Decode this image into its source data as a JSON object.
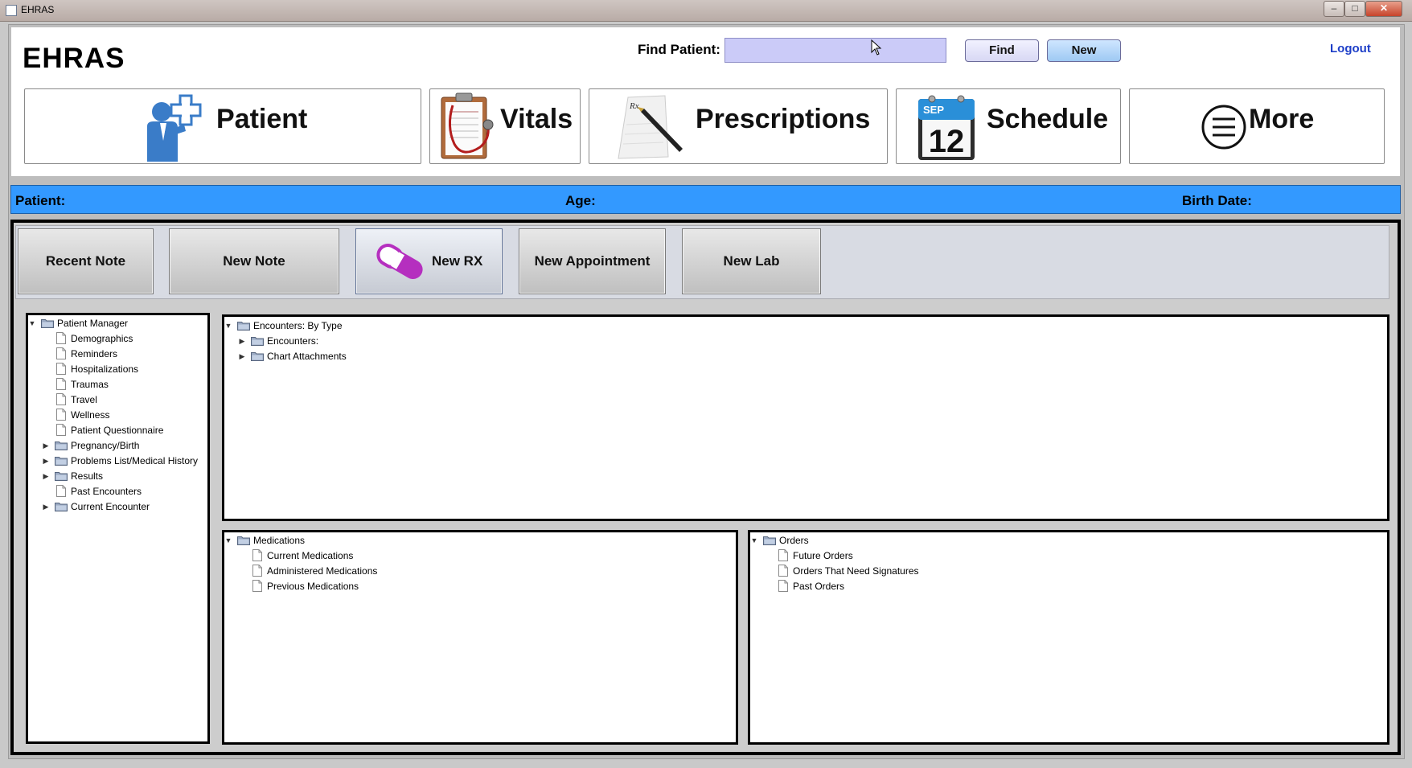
{
  "window": {
    "title": "EHRAS",
    "controls": [
      "–",
      "□",
      "✕"
    ]
  },
  "header": {
    "app_name": "EHRAS",
    "find_label": "Find Patient:",
    "find_value": "",
    "find_button": "Find",
    "new_button": "New",
    "logout": "Logout"
  },
  "nav": [
    {
      "label": "Patient",
      "icon": "patient-icon"
    },
    {
      "label": "Vitals",
      "icon": "clipboard-stethoscope-icon"
    },
    {
      "label": "Prescriptions",
      "icon": "prescription-pen-icon"
    },
    {
      "label": "Schedule",
      "icon": "calendar-icon",
      "calendar_month": "SEP",
      "calendar_day": "12"
    },
    {
      "label": "More",
      "icon": "menu-circle-icon"
    }
  ],
  "patient_bar": {
    "patient_label": "Patient:",
    "age_label": "Age:",
    "birth_label": "Birth Date:"
  },
  "actions": [
    {
      "label": "Recent Note"
    },
    {
      "label": "New Note"
    },
    {
      "label": "New RX",
      "icon": "pill-icon"
    },
    {
      "label": "New Appointment"
    },
    {
      "label": "New Lab"
    }
  ],
  "patient_tree": {
    "root": "Patient Manager",
    "items": [
      {
        "label": "Demographics",
        "type": "doc"
      },
      {
        "label": "Reminders",
        "type": "doc"
      },
      {
        "label": "Hospitalizations",
        "type": "doc"
      },
      {
        "label": "Traumas",
        "type": "doc"
      },
      {
        "label": "Travel",
        "type": "doc"
      },
      {
        "label": "Wellness",
        "type": "doc"
      },
      {
        "label": "Patient Questionnaire",
        "type": "doc"
      },
      {
        "label": "Pregnancy/Birth",
        "type": "folder"
      },
      {
        "label": "Problems List/Medical History",
        "type": "folder"
      },
      {
        "label": "Results",
        "type": "folder"
      },
      {
        "label": "Past Encounters",
        "type": "doc"
      },
      {
        "label": "Current Encounter",
        "type": "folder"
      }
    ]
  },
  "encounters_tree": {
    "root": "Encounters: By Type",
    "items": [
      {
        "label": "Encounters:",
        "type": "folder"
      },
      {
        "label": "Chart Attachments",
        "type": "folder"
      }
    ]
  },
  "medications_tree": {
    "root": "Medications",
    "items": [
      {
        "label": "Current Medications",
        "type": "doc"
      },
      {
        "label": "Administered Medications",
        "type": "doc"
      },
      {
        "label": "Previous Medications",
        "type": "doc"
      }
    ]
  },
  "orders_tree": {
    "root": "Orders",
    "items": [
      {
        "label": "Future Orders",
        "type": "doc"
      },
      {
        "label": "Orders That Need Signatures",
        "type": "doc"
      },
      {
        "label": "Past Orders",
        "type": "doc"
      }
    ]
  },
  "colors": {
    "patient_bar": "#3399ff",
    "find_input": "#cbcbf8",
    "logout": "#1e3fc8",
    "pill": "#b52fbf"
  }
}
